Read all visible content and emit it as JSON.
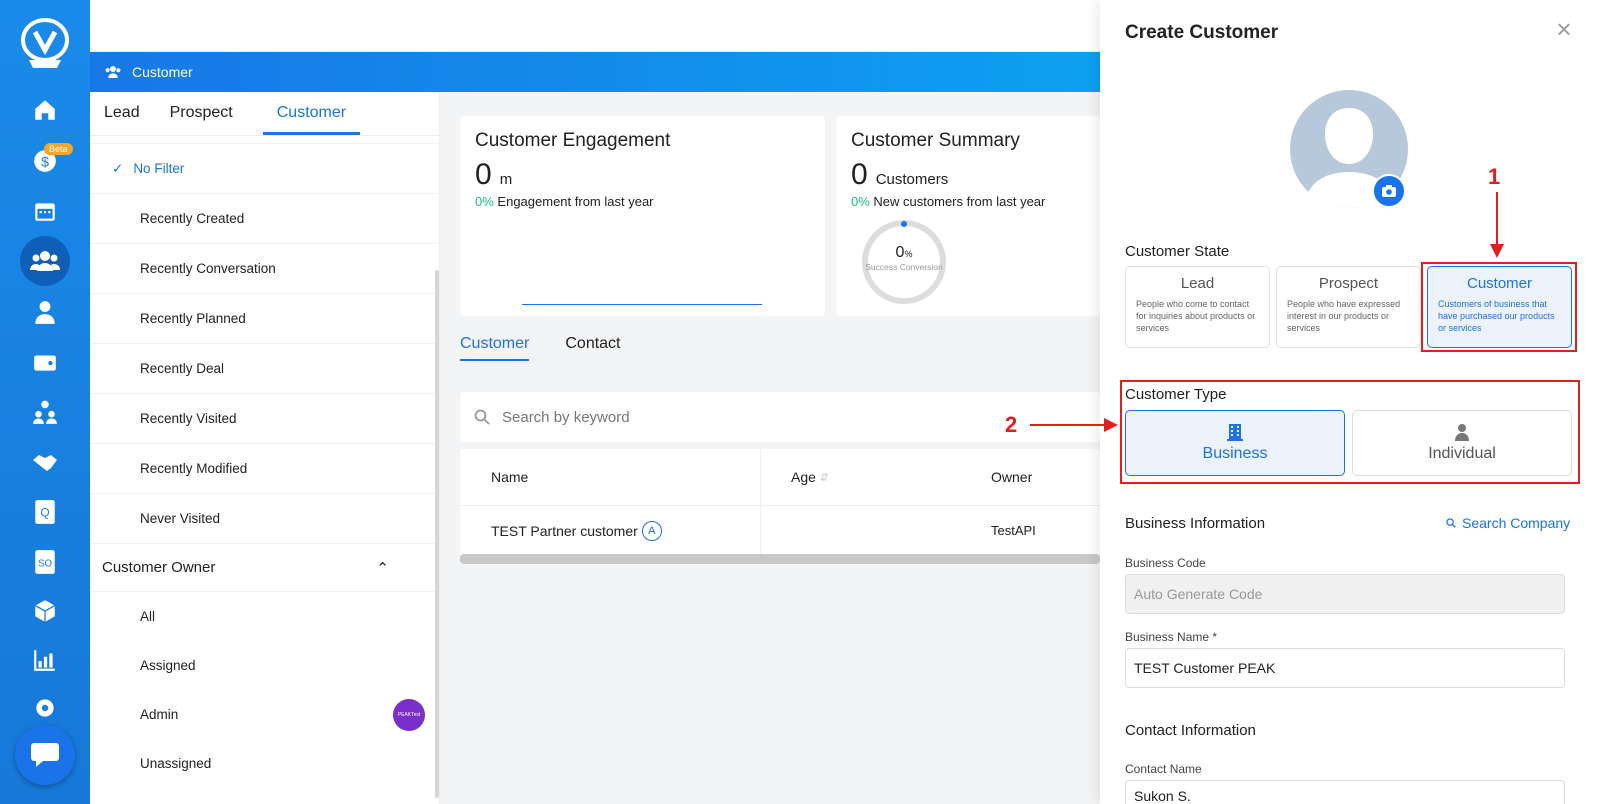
{
  "sidebar": {
    "beta_label": "Beta",
    "icons": [
      "home-icon",
      "chat-dollar-icon",
      "calendar-icon",
      "customers-icon",
      "person-icon",
      "wallet-icon",
      "team-icon",
      "handshake-icon",
      "quotation-icon",
      "sales-order-icon",
      "cube-icon",
      "chart-icon",
      "settings-icon"
    ]
  },
  "header": {
    "section_title": "Customer"
  },
  "left": {
    "tabs": [
      "Lead",
      "Prospect",
      "Customer"
    ],
    "filters": [
      "No Filter",
      "Recently Created",
      "Recently Conversation",
      "Recently Planned",
      "Recently Deal",
      "Recently Visited",
      "Recently Modified",
      "Never Visited"
    ],
    "owner_title": "Customer Owner",
    "owners": [
      "All",
      "Assigned",
      "Admin",
      "Unassigned"
    ],
    "admin_badge": "PEAKTest"
  },
  "engagement": {
    "title": "Customer Engagement",
    "value": "0",
    "unit": "m",
    "pct": "0%",
    "pct_text": "Engagement from last year"
  },
  "summary": {
    "title": "Customer Summary",
    "value": "0",
    "unit": "Customers",
    "pct": "0%",
    "pct_text": "New customers from last year",
    "gauge_value": "0",
    "gauge_unit": "%",
    "gauge_label": "Success Conversion"
  },
  "list": {
    "tabs": [
      "Customer",
      "Contact"
    ],
    "search_placeholder": "Search by keyword",
    "columns": [
      "Name",
      "Age",
      "Owner"
    ],
    "rows": [
      {
        "name": "TEST Partner customer",
        "badge": "A",
        "age": "",
        "owner": "TestAPI"
      }
    ]
  },
  "drawer": {
    "title": "Create Customer",
    "state_title": "Customer State",
    "states": [
      {
        "title": "Lead",
        "desc": "People who come to contact for inquiries about products or services"
      },
      {
        "title": "Prospect",
        "desc": "People who have expressed interest in our products or services"
      },
      {
        "title": "Customer",
        "desc": "Customers of business that have purchased our products or services"
      }
    ],
    "type_title": "Customer Type",
    "types": [
      "Business",
      "Individual"
    ],
    "business_info_title": "Business Information",
    "search_company": "Search Company",
    "business_code_label": "Business Code",
    "business_code_placeholder": "Auto Generate Code",
    "business_name_label": "Business Name *",
    "business_name_value": "TEST Customer PEAK",
    "contact_info_title": "Contact Information",
    "contact_name_label": "Contact Name",
    "contact_name_value": "Sukon S."
  },
  "annotations": {
    "one": "1",
    "two": "2",
    "color": "#e31e1e"
  }
}
